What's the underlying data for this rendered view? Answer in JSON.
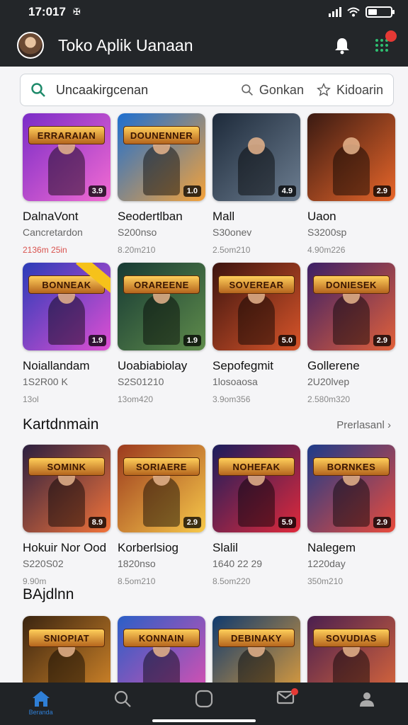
{
  "status": {
    "time": "17:017",
    "time_icon": "cast-icon"
  },
  "header": {
    "title": "Toko Aplik Uanaan",
    "actions": [
      "bell-icon",
      "apps-grid-icon"
    ],
    "badge": ""
  },
  "search": {
    "placeholder": "Uncaakirgcenan",
    "chip1": "Gonkan",
    "chip2": "Kidoarin"
  },
  "row1": [
    {
      "name": "DalnaVont",
      "sub": "Cancretardon",
      "meta": "2136m 25in",
      "rating": "3.9",
      "banner": "ERRARAIAN",
      "c1": "#7a2cc7",
      "c2": "#f36bd2"
    },
    {
      "name": "Seodertlban",
      "sub": "S200nso",
      "meta": "8.20m210",
      "rating": "1.0",
      "banner": "DOUNENNER",
      "c1": "#1d6fd1",
      "c2": "#f4a23a"
    },
    {
      "name": "Mall",
      "sub": "S30onev",
      "meta": "2.5om210",
      "rating": "4.9",
      "banner": "",
      "c1": "#1d2a3a",
      "c2": "#6c7d90"
    },
    {
      "name": "Uaon",
      "sub": "S3200sp",
      "meta": "4.90m226",
      "rating": "2.9",
      "banner": "",
      "c1": "#3a1a12",
      "c2": "#e8662a"
    }
  ],
  "row2": [
    {
      "name": "Noiallandam",
      "sub": "1S2R00 K",
      "meta": "13ol",
      "rating": "1.9",
      "banner": "BONNEAK",
      "c1": "#2a3cb8",
      "c2": "#e04fd3"
    },
    {
      "name": "Uoabiabiolay",
      "sub": "S2S01210",
      "meta": "13om420",
      "rating": "1.9",
      "banner": "ORAREENE",
      "c1": "#173a34",
      "c2": "#5f8c4b"
    },
    {
      "name": "Sepofegmit",
      "sub": "1losoaosa",
      "meta": "3.9om356",
      "rating": "5.0",
      "banner": "SOVEREAR",
      "c1": "#3c140f",
      "c2": "#d9552a"
    },
    {
      "name": "Gollerene",
      "sub": "2U20lvep",
      "meta": "2.580m320",
      "rating": "2.9",
      "banner": "DONIESEK",
      "c1": "#3b1f66",
      "c2": "#e2613a"
    }
  ],
  "section2": {
    "title": "Kartdnmain",
    "more": "Prerlasanl"
  },
  "row3": [
    {
      "name": "Hokuir Nor Ood",
      "sub": "S220S02",
      "meta": "9.90m",
      "rating": "8.9",
      "banner": "SOMINK",
      "c1": "#2b1f3f",
      "c2": "#f2733a"
    },
    {
      "name": "Korberlsiog",
      "sub": "1820nso",
      "meta": "8.5om210",
      "rating": "2.9",
      "banner": "SORIAERE",
      "c1": "#9c3a1e",
      "c2": "#f7c94a"
    },
    {
      "name": "Slalil",
      "sub": "1640 22 29",
      "meta": "8.5om220",
      "rating": "5.9",
      "banner": "NOHEFAK",
      "c1": "#1a1d5c",
      "c2": "#e0293b"
    },
    {
      "name": "Nalegem",
      "sub": "1220day",
      "meta": "350m210",
      "rating": "2.9",
      "banner": "BORNKES",
      "c1": "#1c3b8a",
      "c2": "#e94b3c"
    }
  ],
  "section3": {
    "title": "BAjdlnn"
  },
  "row4": [
    {
      "banner": "SNIOPIAT",
      "c1": "#3a2410",
      "c2": "#d98a2a"
    },
    {
      "banner": "KONNAIN",
      "c1": "#2a5fc7",
      "c2": "#e24fb0"
    },
    {
      "banner": "DEBINAKY",
      "c1": "#0f3a6e",
      "c2": "#e8a23a"
    },
    {
      "banner": "SOVUDIAS",
      "c1": "#4a1f4f",
      "c2": "#e06a3a"
    }
  ],
  "nav": {
    "home_label": "Beranda"
  }
}
